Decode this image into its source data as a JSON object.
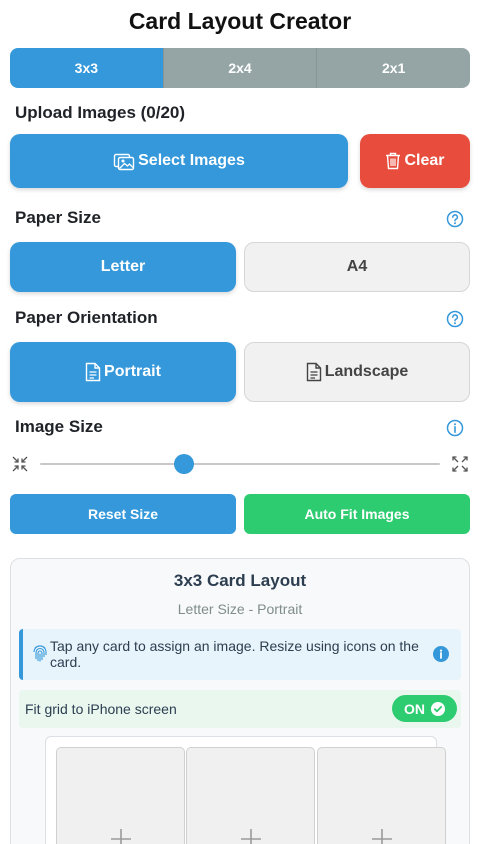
{
  "app": {
    "title": "Card Layout Creator"
  },
  "layout_tabs": [
    {
      "label": "3x3",
      "active": true
    },
    {
      "label": "2x4",
      "active": false
    },
    {
      "label": "2x1",
      "active": false
    }
  ],
  "upload": {
    "title": "Upload Images (0/20)",
    "select_label": "Select Images",
    "clear_label": "Clear"
  },
  "paper_size": {
    "title": "Paper Size",
    "options": [
      {
        "label": "Letter",
        "selected": true
      },
      {
        "label": "A4",
        "selected": false
      }
    ]
  },
  "orientation": {
    "title": "Paper Orientation",
    "options": [
      {
        "label": "Portrait",
        "selected": true
      },
      {
        "label": "Landscape",
        "selected": false
      }
    ]
  },
  "image_size": {
    "title": "Image Size",
    "slider_fraction": 0.36,
    "reset_label": "Reset Size",
    "autofit_label": "Auto Fit Images"
  },
  "preview": {
    "title": "3x3 Card Layout",
    "subtitle": "Letter Size - Portrait",
    "info_text": "Tap any card to assign an image. Resize using icons on the card.",
    "fit_label": "Fit grid to iPhone screen",
    "toggle_label": "ON",
    "cards": [
      {},
      {},
      {}
    ]
  },
  "icons": {
    "upload": "image-icon",
    "clear": "trash-icon",
    "help": "question-circle-icon",
    "info": "info-circle-icon",
    "shrink": "compress-icon",
    "grow": "expand-icon",
    "page": "file-text-icon",
    "fingerprint": "fingerprint-icon",
    "check": "check-circle-icon",
    "add": "plus-icon"
  },
  "colors": {
    "primary": "#3498db",
    "danger": "#e74c3c",
    "success": "#2ecc71",
    "inactive_tab": "#95a5a6"
  }
}
